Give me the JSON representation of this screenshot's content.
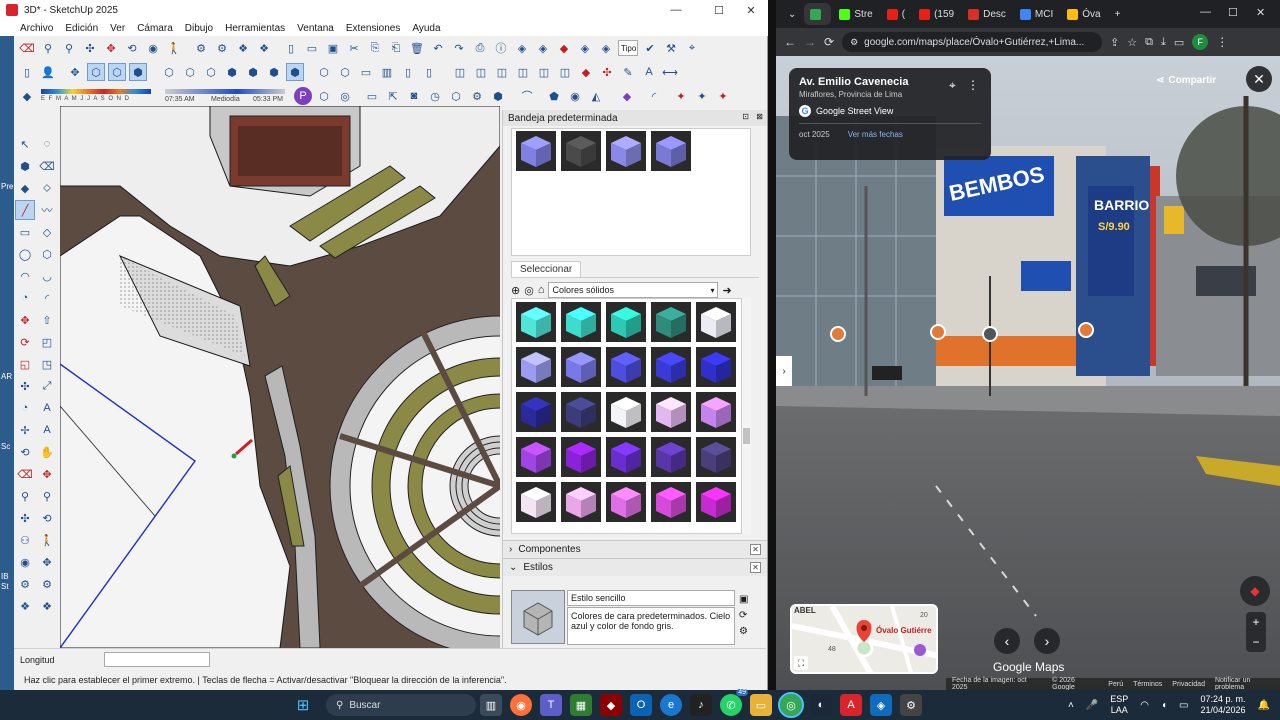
{
  "sketchup": {
    "title": "3D* - SketchUp 2025",
    "window_controls": [
      "—",
      "☐",
      "✕"
    ],
    "menu": [
      "Archivo",
      "Edición",
      "Ver",
      "Cámara",
      "Dibujo",
      "Herramientas",
      "Ventana",
      "Extensiones",
      "Ayuda"
    ],
    "toolbar_field": "Tipo",
    "shadow": {
      "months": "E F M A M J J A S O N D",
      "time_start": "07:35 AM",
      "time_mid": "Mediodía",
      "time_end": "05:33 PM"
    },
    "tray": {
      "title": "Bandeja predeterminada",
      "select_tab": "Seleccionar",
      "library": "Colores sólidos",
      "components": "Componentes",
      "styles": "Estilos",
      "style_name": "Estilo sencillo",
      "style_desc": "Colores de cara predeterminados. Cielo azul y color de fondo gris."
    },
    "measure_label": "Longitud",
    "measure_value": "",
    "status": "Haz clic para establecer el primer extremo. | Teclas de flecha = Activar/desactivar \"Bloquear la dirección de la inferencia\".",
    "left_strip_labels": [
      "Pre",
      "AR",
      "Sc",
      "IB",
      "St"
    ]
  },
  "colors": {
    "recent": [
      "#7f7fe6",
      "#4a4a4a",
      "#8a8ae6",
      "#7a7ad6"
    ],
    "swatches": [
      "#4fe6d8",
      "#3ddccd",
      "#2cc9b4",
      "#2f8c7c",
      "#ececf7",
      "#9b9bf2",
      "#7878e8",
      "#4d4de0",
      "#3a3ad6",
      "#2f2fc9",
      "#2a2a9a",
      "#3c3c7a",
      "#f3f3fa",
      "#e3b8f0",
      "#c583ec",
      "#a044e6",
      "#8a22d9",
      "#6a2ed0",
      "#5a35a8",
      "#4a3f7a",
      "#f2e6f5",
      "#e9a6e9",
      "#df6fe6",
      "#d64ad9",
      "#c72ad0"
    ]
  },
  "chrome": {
    "tabs": [
      {
        "label": "",
        "color": "#34a853",
        "active": true
      },
      {
        "label": "Stre",
        "color": "#53fc18"
      },
      {
        "label": "(",
        "color": "#e62117"
      },
      {
        "label": "(159",
        "color": "#e62117"
      },
      {
        "label": "Desc",
        "color": "#d93025"
      },
      {
        "label": "MCI",
        "color": "#4285f4"
      },
      {
        "label": "Óva",
        "color": "#ffbc0d"
      }
    ],
    "url": "google.com/maps/place/Óvalo+Gutiérrez,+Lima...",
    "profile_initial": "F",
    "street_view": {
      "place": "Av. Emilio Cavenecia",
      "area": "Miraflores, Provincia de Lima",
      "source": "Google Street View",
      "date": "oct 2025",
      "more_dates": "Ver más fechas",
      "share": "Compartir",
      "map_label": "Óvalo Gutiérre",
      "map_street": "ABEL",
      "map_number": "48",
      "map_number2": "20",
      "brand": "Google Maps",
      "footer": [
        "Fecha de la imagen: oct 2025",
        "© 2026 Google",
        "Perú",
        "Términos",
        "Privacidad",
        "Notificar un problema"
      ],
      "sign_text": "BEMBOS",
      "banner_text": "BARRIO",
      "banner_price": "S/9.90"
    }
  },
  "taskbar": {
    "search": "Buscar",
    "lang": "ESP",
    "lang2": "LAA",
    "time": "07:24 p. m.",
    "date": "21/04/2026",
    "badge": "49"
  }
}
